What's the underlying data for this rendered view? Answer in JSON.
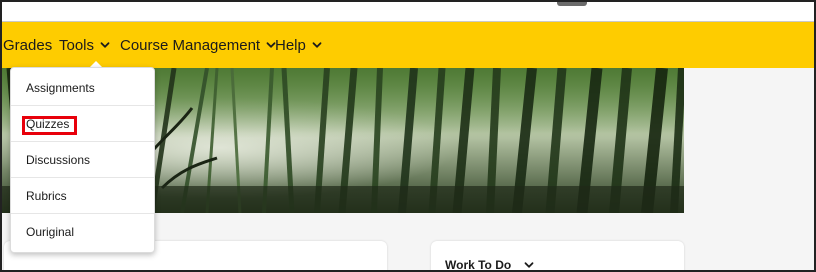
{
  "navbar": {
    "items": [
      {
        "label": "Grades",
        "has_chevron": false
      },
      {
        "label": "Tools",
        "has_chevron": true
      },
      {
        "label": "Course Management",
        "has_chevron": true
      },
      {
        "label": "Help",
        "has_chevron": true
      }
    ]
  },
  "tools_menu": {
    "items": [
      "Assignments",
      "Quizzes",
      "Discussions",
      "Rubrics",
      "Ouriginal"
    ],
    "highlighted": "Quizzes"
  },
  "widgets": {
    "work_to_do": {
      "title": "Work To Do"
    }
  },
  "colors": {
    "navbar": "#fecc00",
    "highlight": "#e8000b"
  },
  "icons": [
    "chevron-down-icon"
  ]
}
